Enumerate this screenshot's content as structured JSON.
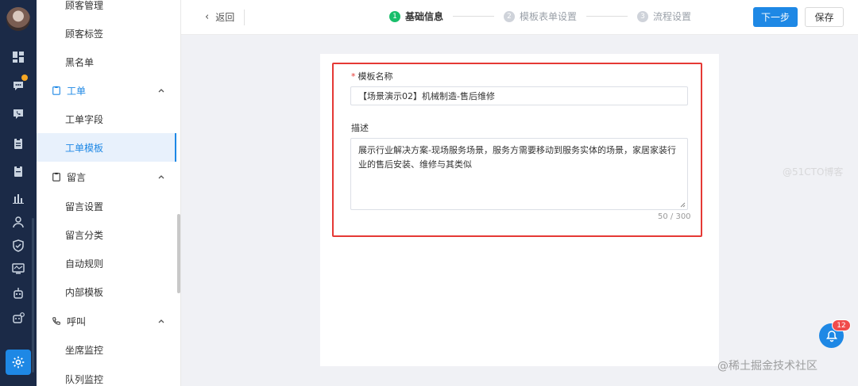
{
  "header": {
    "back_label": "返回",
    "steps": [
      {
        "num": "1",
        "label": "基础信息",
        "state": "done"
      },
      {
        "num": "2",
        "label": "模板表单设置",
        "state": "todo"
      },
      {
        "num": "3",
        "label": "流程设置",
        "state": "todo"
      }
    ],
    "next_label": "下一步",
    "save_label": "保存"
  },
  "sidebar": {
    "items": [
      {
        "label": "顾客管理",
        "type": "item"
      },
      {
        "label": "顾客标签",
        "type": "item"
      },
      {
        "label": "黑名单",
        "type": "item"
      },
      {
        "label": "工单",
        "type": "group"
      },
      {
        "label": "工单字段",
        "type": "item"
      },
      {
        "label": "工单模板",
        "type": "item",
        "selected": true
      },
      {
        "label": "留言",
        "type": "group"
      },
      {
        "label": "留言设置",
        "type": "item"
      },
      {
        "label": "留言分类",
        "type": "item"
      },
      {
        "label": "自动规则",
        "type": "item"
      },
      {
        "label": "内部模板",
        "type": "item"
      },
      {
        "label": "呼叫",
        "type": "group"
      },
      {
        "label": "坐席监控",
        "type": "item"
      },
      {
        "label": "队列监控",
        "type": "item"
      }
    ]
  },
  "form": {
    "name_required_mark": "*",
    "name_label": "模板名称",
    "name_value": "【场景演示02】机械制造-售后维修",
    "desc_label": "描述",
    "desc_value": "展示行业解决方案-现场服务场景，服务方需要移动到服务实体的场景，家居家装行业的售后安装、维修与其类似",
    "counter": "50 / 300"
  },
  "notification": {
    "count": "12"
  },
  "watermark": {
    "text": "@稀土掘金技术社区",
    "faint": "@51CTO博客"
  },
  "colors": {
    "accent": "#1e88e5",
    "success": "#19be6b",
    "highlight": "#e53935",
    "rail": "#1b2a47"
  }
}
